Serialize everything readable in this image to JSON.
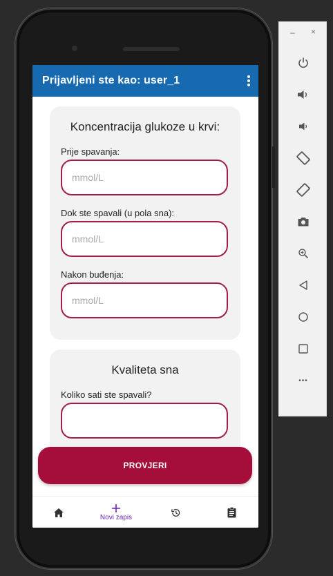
{
  "appbar": {
    "title": "Prijavljeni ste kao: user_1",
    "menu_icon": "more-vert-icon"
  },
  "glucose_card": {
    "title": "Koncentracija glukoze u krvi:",
    "fields": [
      {
        "label": "Prije spavanja:",
        "placeholder": "mmol/L"
      },
      {
        "label": "Dok ste spavali (u pola sna):",
        "placeholder": "mmol/L"
      },
      {
        "label": "Nakon buđenja:",
        "placeholder": "mmol/L"
      }
    ]
  },
  "sleep_card": {
    "title": "Kvaliteta sna",
    "fields": [
      {
        "label": "Koliko sati ste spavali?",
        "placeholder": ""
      }
    ]
  },
  "check_button": {
    "label": "PROVJERI"
  },
  "bottom_nav": {
    "items": [
      {
        "icon": "home-icon",
        "label": ""
      },
      {
        "icon": "plus-icon",
        "label": "Novi zapis"
      },
      {
        "icon": "history-icon",
        "label": ""
      },
      {
        "icon": "clipboard-icon",
        "label": ""
      }
    ]
  },
  "colors": {
    "appbar": "#1769b0",
    "field_border": "#a01d4b",
    "button": "#a50d3a",
    "nav_active": "#6a23b5",
    "card_bg": "#f2f2f2"
  },
  "emulator_panel": {
    "minimize_label": "–",
    "close_label": "×",
    "buttons": [
      "power-icon",
      "volume-up-icon",
      "volume-down-icon",
      "rotate-left-icon",
      "rotate-right-icon",
      "camera-icon",
      "zoom-icon",
      "back-icon",
      "home-circle-icon",
      "overview-icon",
      "more-icon"
    ],
    "more_label": "•••"
  }
}
